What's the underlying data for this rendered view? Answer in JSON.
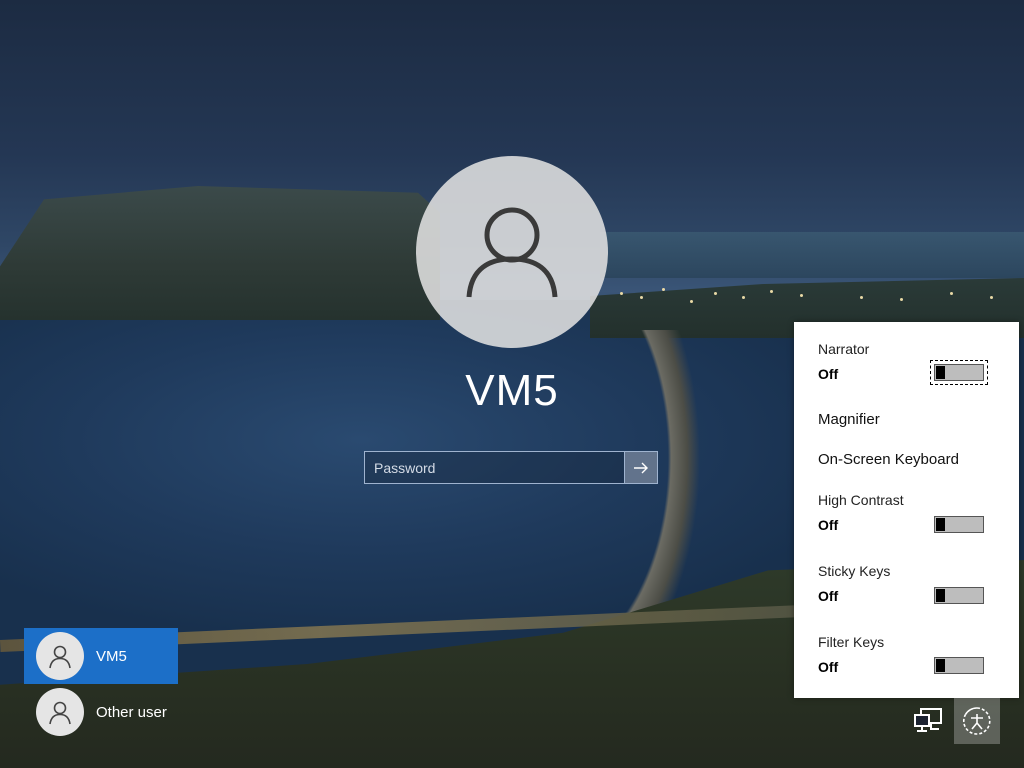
{
  "user": {
    "name": "VM5",
    "password_placeholder": "Password"
  },
  "user_list": [
    {
      "label": "VM5",
      "selected": true
    },
    {
      "label": "Other user",
      "selected": false
    }
  ],
  "ease_of_access": {
    "narrator": {
      "label": "Narrator",
      "state": "Off"
    },
    "magnifier": {
      "label": "Magnifier"
    },
    "onscreen_keyboard": {
      "label": "On-Screen Keyboard"
    },
    "high_contrast": {
      "label": "High Contrast",
      "state": "Off"
    },
    "sticky_keys": {
      "label": "Sticky Keys",
      "state": "Off"
    },
    "filter_keys": {
      "label": "Filter Keys",
      "state": "Off"
    }
  },
  "icons": {
    "submit": "arrow-right-icon",
    "network": "network-icon",
    "ease_of_access": "ease-of-access-icon",
    "user": "user-icon"
  },
  "colors": {
    "accent": "#1c6fc8",
    "flyout_bg": "#ffffff"
  }
}
